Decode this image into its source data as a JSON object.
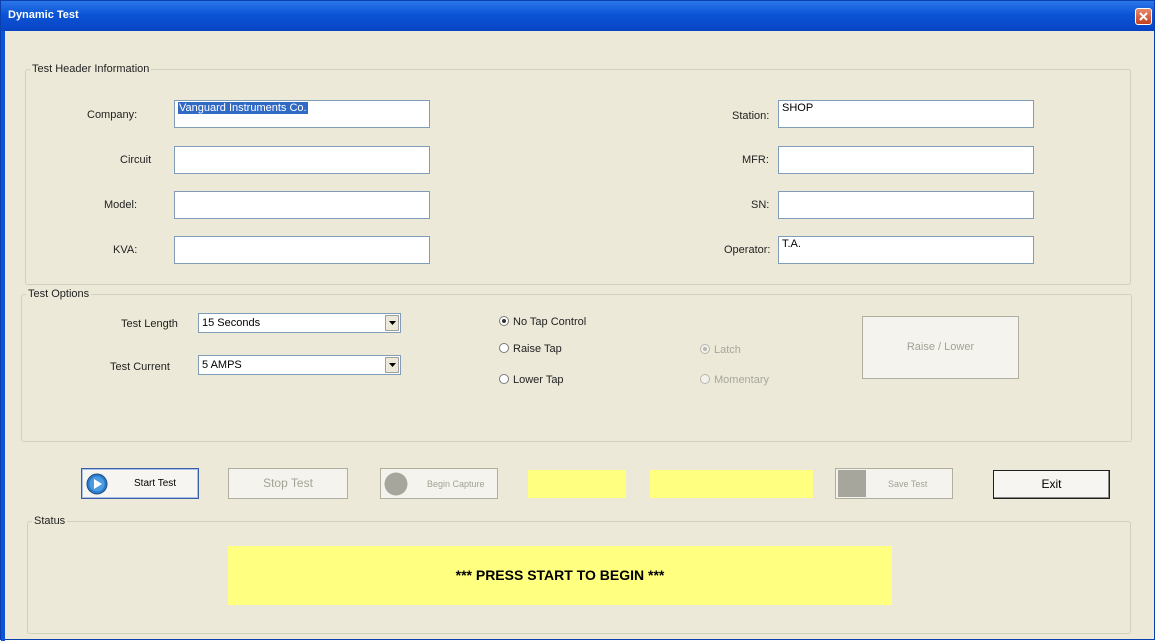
{
  "window": {
    "title": "Dynamic Test"
  },
  "header_group": {
    "legend": "Test Header Information",
    "company": {
      "label": "Company:",
      "value": "Vanguard Instruments Co."
    },
    "circuit": {
      "label": "Circuit",
      "value": ""
    },
    "model": {
      "label": "Model:",
      "value": ""
    },
    "kva": {
      "label": "KVA:",
      "value": ""
    },
    "station": {
      "label": "Station:",
      "value": "SHOP"
    },
    "mfr": {
      "label": "MFR:",
      "value": ""
    },
    "sn": {
      "label": "SN:",
      "value": ""
    },
    "operator": {
      "label": "Operator:",
      "value": "T.A."
    }
  },
  "options_group": {
    "legend": "Test Options",
    "test_length": {
      "label": "Test Length",
      "value": "15 Seconds"
    },
    "test_current": {
      "label": "Test Current",
      "value": "5 AMPS"
    },
    "tap_control": [
      {
        "label": "No Tap Control",
        "selected": true
      },
      {
        "label": "Raise Tap",
        "selected": false
      },
      {
        "label": "Lower Tap",
        "selected": false
      }
    ],
    "mode": [
      {
        "label": "Latch",
        "selected": true
      },
      {
        "label": "Momentary",
        "selected": false
      }
    ],
    "raise_lower_label": "Raise / Lower"
  },
  "toolbar": {
    "start_label": "Start Test",
    "stop_label": "Stop Test",
    "capture_label": "Begin Capture",
    "save_label": "Save Test",
    "exit_label": "Exit"
  },
  "status_group": {
    "legend": "Status",
    "message": "*** PRESS START TO BEGIN ***"
  },
  "colors": {
    "status_yellow": "#ffff80",
    "title_blue": "#0b54d6",
    "window_bg": "#ece9d8"
  }
}
